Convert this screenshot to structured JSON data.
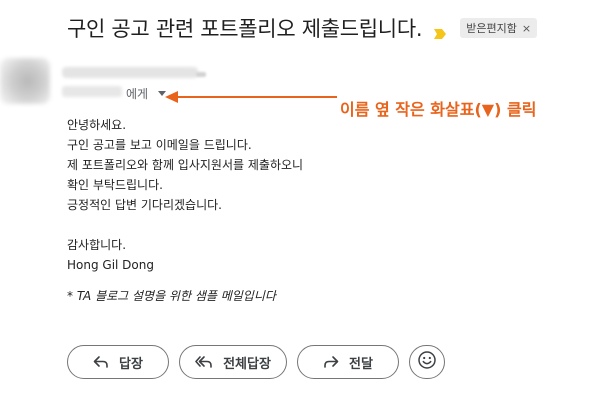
{
  "email": {
    "subject": "구인 공고 관련 포트폴리오 제출드립니다.",
    "label": "받은편지함",
    "label_close": "×",
    "to_suffix": "에게",
    "body_lines": [
      "안녕하세요.",
      "구인 공고를 보고 이메일을 드립니다.",
      "제 포트폴리오와 함께 입사지원서를 제출하오니",
      "확인 부탁드립니다.",
      "긍정적인 답변 기다리겠습니다."
    ],
    "closing": "감사합니다.",
    "signature": "Hong Gil Dong",
    "footnote": "* TA 블로그 설명을 위한 샘플 메일입니다"
  },
  "annotation": {
    "text": "이름 옆 작은 화살표(▼) 클릭",
    "color": "#e8641c"
  },
  "actions": {
    "reply": "답장",
    "reply_all": "전체답장",
    "forward": "전달"
  },
  "icons": {
    "importance": "importance-marker-icon",
    "caret": "caret-down-icon",
    "reply": "reply-icon",
    "reply_all": "reply-all-icon",
    "forward": "forward-icon",
    "emoji": "emoji-icon"
  },
  "colors": {
    "importance": "#f5c518",
    "annotation": "#e8641c"
  }
}
